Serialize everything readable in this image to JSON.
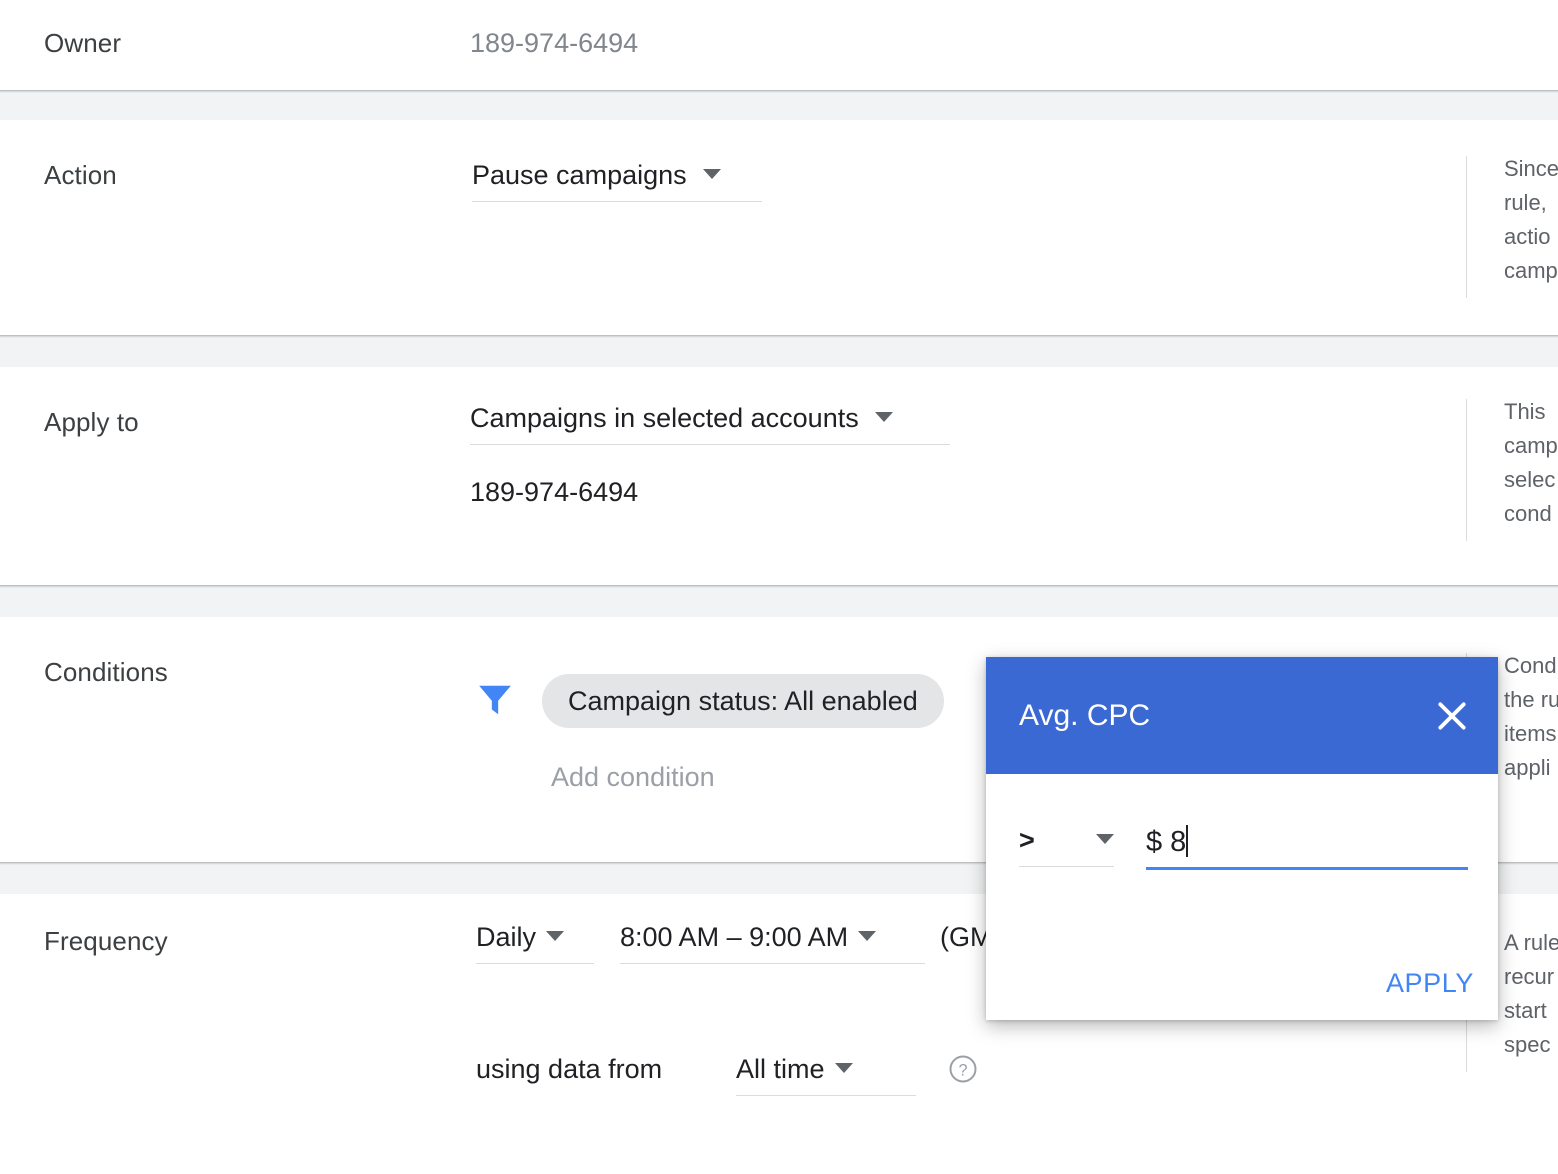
{
  "sections": {
    "owner": {
      "label": "Owner",
      "value": "189-974-6494"
    },
    "action": {
      "label": "Action",
      "dropdown_value": "Pause campaigns",
      "help_text": "Since\nrule, \nactio\ncamp"
    },
    "apply_to": {
      "label": "Apply to",
      "dropdown_value": "Campaigns in selected accounts",
      "account": "189-974-6494",
      "help_text": "This \ncamp\nselec\ncond"
    },
    "conditions": {
      "label": "Conditions",
      "chip": "Campaign status: All enabled",
      "add_condition": "Add condition",
      "help_text": "Cond\nthe ru\nitems\nappli",
      "filter_icon": "filter-funnel-icon",
      "chip_bg": "#e4e5e7",
      "filter_color": "#4285f4"
    },
    "frequency": {
      "label": "Frequency",
      "interval": "Daily",
      "time_range": "8:00 AM – 9:00 AM",
      "timezone": "(GM",
      "using_data_from_label": "using data from",
      "data_range": "All time",
      "help_icon": "question-mark-circle-icon",
      "help_text": "A rule\nrecur\nstart \nspec"
    }
  },
  "dialog": {
    "title": "Avg. CPC",
    "close_icon": "close-x-icon",
    "operator": ">",
    "value": "$ 8",
    "apply_label": "APPLY",
    "header_color": "#3b69d4",
    "accent_color": "#4285f4"
  }
}
